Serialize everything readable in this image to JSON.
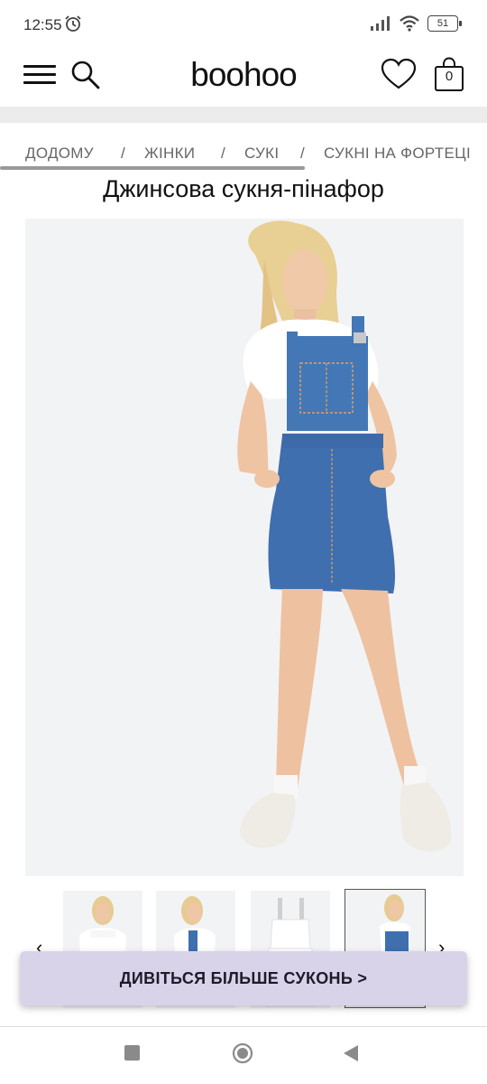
{
  "status": {
    "time": "12:55",
    "battery": "51"
  },
  "header": {
    "logo": "boohoo",
    "bag_count": "0"
  },
  "breadcrumb": [
    "ДОДОМУ",
    "/",
    "ЖІНКИ",
    "/",
    "СУКІ",
    "/",
    "СУКНІ НА ФОРТЕЦІ"
  ],
  "product": {
    "title": "Джинсова сукня-пінафор"
  },
  "gallery": {
    "prev_arrow": "‹",
    "next_arrow": "›",
    "thumb_count": 4,
    "selected_index": 3
  },
  "cta": {
    "label": "ДИВІТЬСЯ БІЛЬШЕ СУКОНЬ >"
  },
  "colors": {
    "cta_bg": "#d9d3ea",
    "denim": "#3f6fae",
    "background": "#f2f3f5"
  }
}
